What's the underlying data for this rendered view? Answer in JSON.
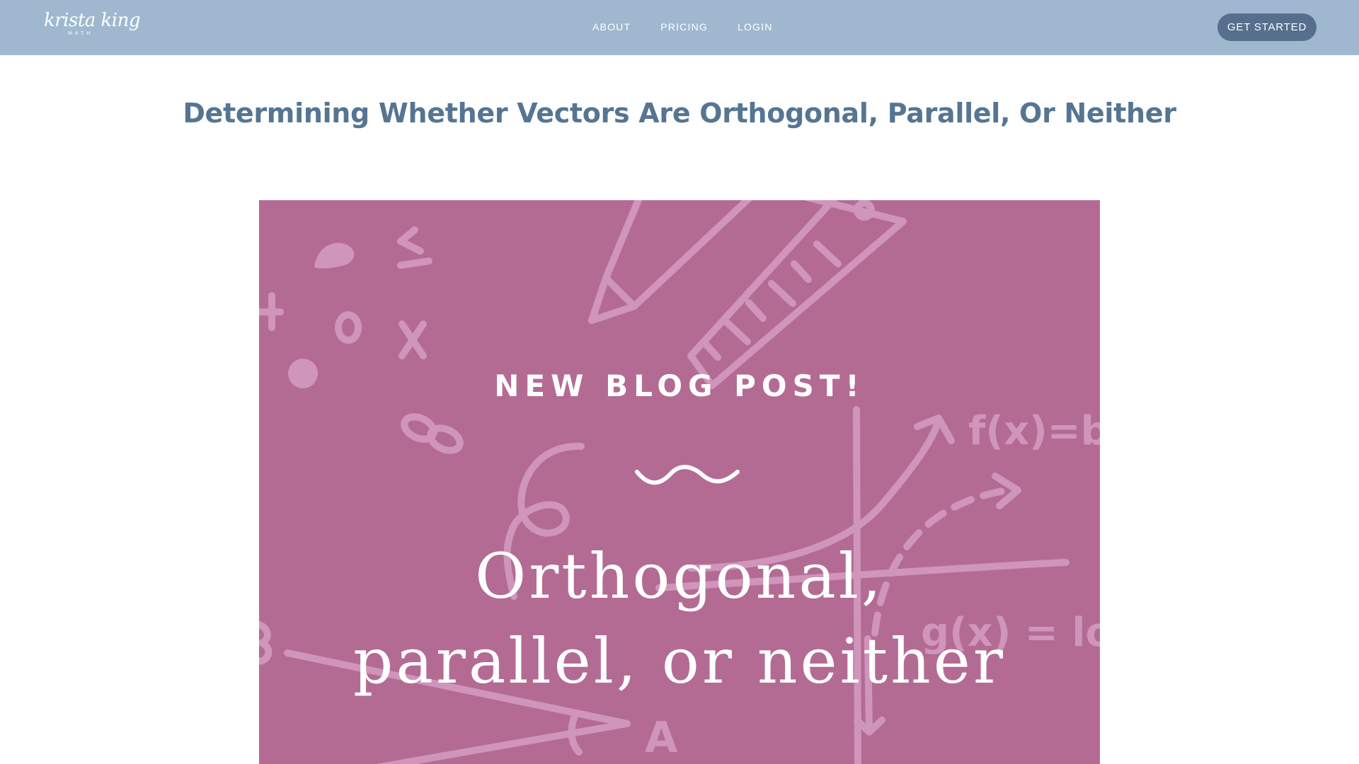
{
  "header": {
    "logo": {
      "script": "krista king",
      "sub": "MATH",
      "icon": "krista-king-math-logo"
    },
    "nav": [
      {
        "label": "ABOUT"
      },
      {
        "label": "PRICING"
      },
      {
        "label": "LOGIN"
      }
    ],
    "cta_label": "GET STARTED"
  },
  "main": {
    "title": "Determining Whether Vectors Are Orthogonal, Parallel, Or Neither",
    "hero": {
      "kicker": "NEW BLOG POST!",
      "line1": "Orthogonal,",
      "line2": "parallel, or neither",
      "doodle_texts": {
        "fx": "f(x)=b",
        "gx": "g(x) = log",
        "vertex": "A",
        "le": "≤"
      }
    }
  },
  "colors": {
    "header_bg": "#9fb8cf",
    "cta_bg": "#566f8d",
    "title": "#557592",
    "hero_bg": "#b46b93",
    "doodle": "#cf95bb"
  }
}
